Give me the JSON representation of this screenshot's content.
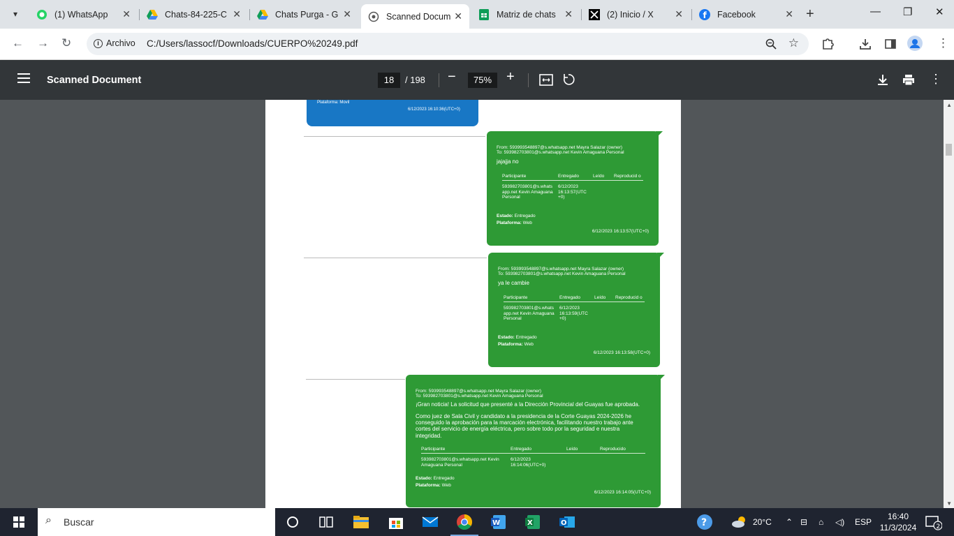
{
  "tabs": [
    {
      "label": "(1) WhatsApp",
      "icon": "whatsapp-icon"
    },
    {
      "label": "Chats-84-225-C",
      "icon": "google-drive-icon"
    },
    {
      "label": "Chats Purga - G",
      "icon": "google-drive-icon"
    },
    {
      "label": "Scanned Docum",
      "icon": "globe-icon",
      "active": true
    },
    {
      "label": "Matriz de chats",
      "icon": "google-sheets-icon"
    },
    {
      "label": "(2) Inicio / X",
      "icon": "x-icon"
    },
    {
      "label": "Facebook",
      "icon": "facebook-icon"
    }
  ],
  "address": {
    "scheme_label": "Archivo",
    "url": "C:/Users/lassocf/Downloads/CUERPO%20249.pdf"
  },
  "pdf_toolbar": {
    "title": "Scanned Document",
    "page": "18",
    "total_pages": "/ 198",
    "zoom": "75%"
  },
  "document": {
    "blue_bubble": {
      "platform": "Plataforma: Movil",
      "time": "6/12/2023 16:10:36(UTC+0)"
    },
    "messages": [
      {
        "from": "From: 593993548897@s.whatsapp.net Mayra Salazar (owner)",
        "to": "To: 593982703801@s.whatsapp.net Kevin Amaguana Personal",
        "body": "jajajja no",
        "headers": [
          "Participante",
          "Entregado",
          "Leído",
          "Reproducid o"
        ],
        "row": [
          "593982703801@s.whats app.net Kevin Amaguana Personal",
          "6/12/2023 16:13:57(UTC +0)",
          "",
          ""
        ],
        "estado": "Estado:",
        "estado_val": "Entregado",
        "plataforma": "Plataforma:",
        "plataforma_val": "Web",
        "time": "6/12/2023 16:13:57(UTC+0)"
      },
      {
        "from": "From: 593993548897@s.whatsapp.net Mayra Salazar (owner)",
        "to": "To: 593982703801@s.whatsapp.net Kevin Amaguana Personal",
        "body": "ya le cambie",
        "headers": [
          "Participante",
          "Entregado",
          "Leído",
          "Reproducid o"
        ],
        "row": [
          "593982703801@s.whats app.net Kevin Amaguana Personal",
          "6/12/2023 16:13:59(UTC +0)",
          "",
          ""
        ],
        "estado": "Estado:",
        "estado_val": "Entregado",
        "plataforma": "Plataforma:",
        "plataforma_val": "Web",
        "time": "6/12/2023 16:13:58(UTC+0)"
      },
      {
        "from": "From: 593993548897@s.whatsapp.net Mayra Salazar (owner)",
        "to": "To: 593982703801@s.whatsapp.net Kevin Amaguana Personal",
        "body": "¡Gran noticia!  La solicitud que presenté a la Dirección Provincial del Guayas fue aprobada.",
        "body2": "Como juez de Sala Civil y candidato a la presidencia de la Corte Guayas 2024-2026 he conseguido la aprobación para la marcación electrónica, facilitando nuestro trabajo ante cortes del servicio de energía eléctrica, pero sobre todo por la seguridad e nuestra integridad.",
        "headers": [
          "Participante",
          "Entregado",
          "Leído",
          "Reproducido"
        ],
        "row": [
          "593982703801@s.whatsapp.net Kevin Amaguana Personal",
          "6/12/2023 16:14:06(UTC+0)",
          "",
          ""
        ],
        "estado": "Estado:",
        "estado_val": "Entregado",
        "plataforma": "Plataforma:",
        "plataforma_val": "Web",
        "time": "6/12/2023 16:14:05(UTC+0)"
      }
    ]
  },
  "taskbar": {
    "search_placeholder": "Buscar",
    "weather": "20°C",
    "language": "ESP",
    "time": "16:40",
    "date": "11/3/2024",
    "notifications": "2"
  },
  "colors": {
    "accent_green": "#2e9a35",
    "accent_blue": "#1877c5",
    "pdf_toolbar": "#323639"
  }
}
